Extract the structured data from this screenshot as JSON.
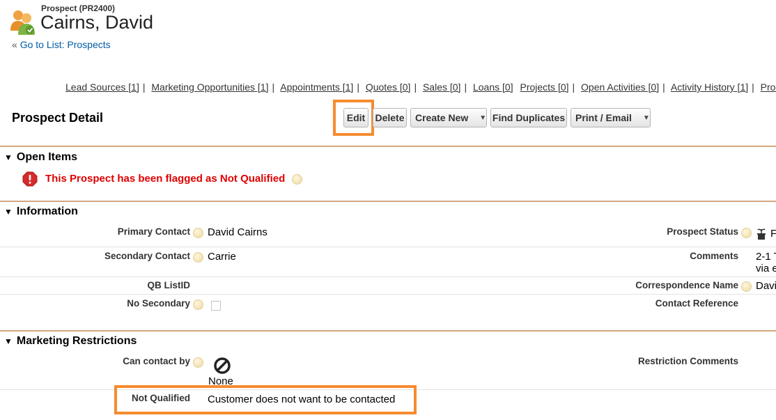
{
  "header": {
    "object_type": "Prospect (PR2400)",
    "record_name": "Cairns, David",
    "back_prefix": "«",
    "back_link": "Go to List: Prospects"
  },
  "related_links": [
    {
      "label": "Lead Sources [1]"
    },
    {
      "label": "Marketing Opportunities [1]"
    },
    {
      "label": "Appointments [1]"
    },
    {
      "label": "Quotes [0]"
    },
    {
      "label": "Sales [0]"
    },
    {
      "label": "Loans [0]"
    },
    {
      "label": "Projects [0]"
    },
    {
      "label": "Open Activities [0]"
    },
    {
      "label": "Activity History [1]"
    },
    {
      "label": "Prosp"
    }
  ],
  "detail": {
    "title": "Prospect Detail",
    "buttons": {
      "edit": "Edit",
      "delete": "Delete",
      "create_new": "Create New",
      "find_duplicates": "Find Duplicates",
      "print_email": "Print / Email"
    }
  },
  "open_items": {
    "title": "Open Items",
    "message": "This Prospect has been flagged as Not Qualified"
  },
  "information": {
    "title": "Information",
    "primary_contact_label": "Primary Contact",
    "primary_contact_value": "David Cairns",
    "secondary_contact_label": "Secondary Contact",
    "secondary_contact_value": "Carrie",
    "qb_listid_label": "QB ListID",
    "no_secondary_label": "No Secondary",
    "no_secondary_checked": false,
    "prospect_status_label": "Prospect Status",
    "prospect_status_value": "F",
    "comments_label": "Comments",
    "comments_line1": "2-1 T",
    "comments_line2": "via e",
    "correspondence_label": "Correspondence Name",
    "correspondence_value": "Davi",
    "contact_reference_label": "Contact Reference"
  },
  "marketing": {
    "title": "Marketing Restrictions",
    "can_contact_label": "Can contact by",
    "can_contact_value": "None",
    "restriction_comments_label": "Restriction Comments",
    "not_qualified_label": "Not Qualified",
    "not_qualified_value": "Customer does not want to be contacted"
  },
  "colors": {
    "highlight": "#f68b2e",
    "section_line": "#d5a57d",
    "error_text": "#e00000",
    "link": "#015ba7"
  }
}
